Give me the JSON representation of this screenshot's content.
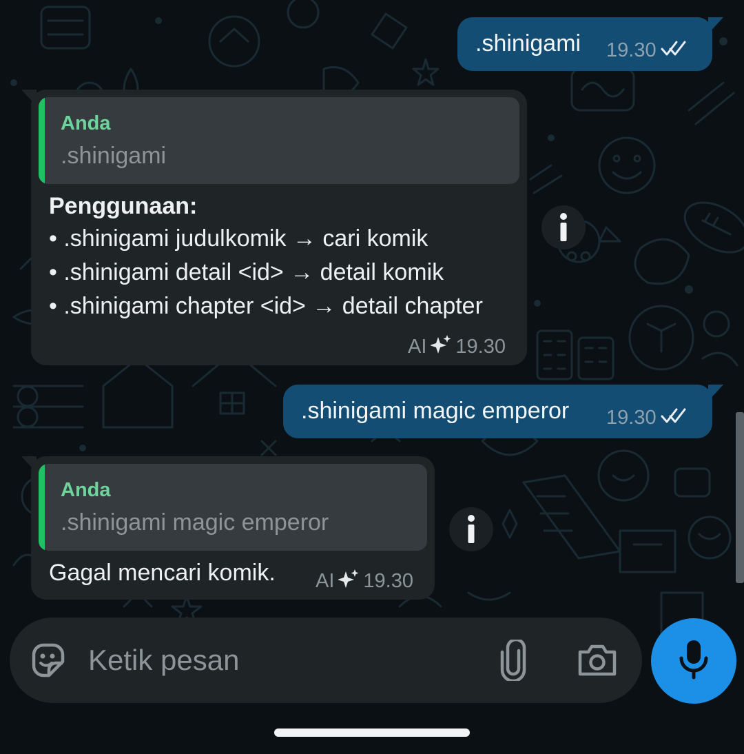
{
  "messages": [
    {
      "type": "outgoing",
      "text": ".shinigami",
      "time": "19.30",
      "status_icon": "double-check-icon"
    },
    {
      "type": "incoming",
      "quote": {
        "author": "Anda",
        "text": ".shinigami"
      },
      "lines": [
        "Penggunaan:",
        "• .shinigami judulkomik → cari komik",
        "• .shinigami detail <id> → detail komik",
        "• .shinigami chapter <id> → detail chapter"
      ],
      "ai_label": "AI",
      "time": "19.30"
    },
    {
      "type": "outgoing",
      "text": ".shinigami magic emperor",
      "time": "19.30",
      "status_icon": "double-check-icon"
    },
    {
      "type": "incoming",
      "quote": {
        "author": "Anda",
        "text": ".shinigami magic emperor"
      },
      "lines": [
        "Gagal mencari komik."
      ],
      "ai_label": "AI",
      "time": "19.30"
    }
  ],
  "composer": {
    "placeholder": "Ketik pesan",
    "icons": [
      "sticker-icon",
      "paperclip-icon",
      "camera-icon",
      "microphone-icon"
    ]
  },
  "colors": {
    "background": "#0b1014",
    "outgoing_bubble": "#134d73",
    "incoming_bubble": "#1f2427",
    "quote_bar": "#21c063",
    "quote_author": "#6fd49b",
    "mic_button": "#1c8fe6"
  }
}
